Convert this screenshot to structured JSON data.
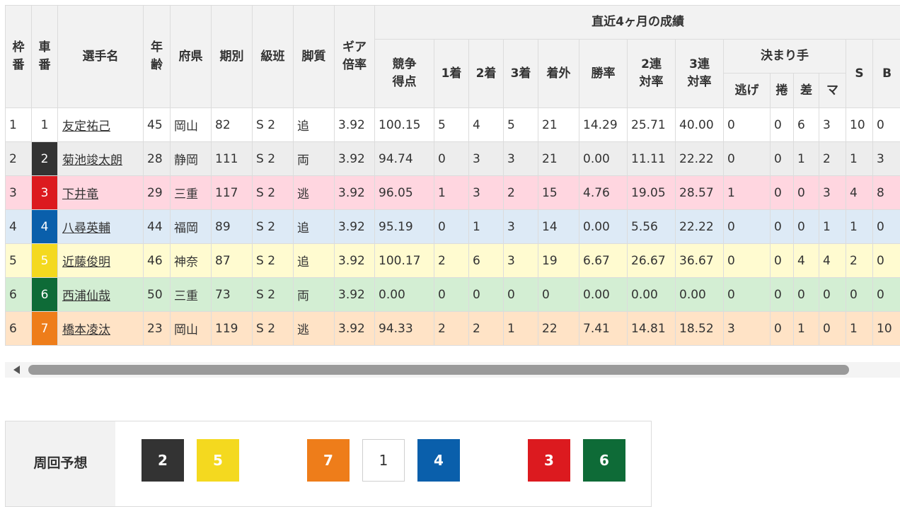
{
  "headers": {
    "waku": "枠番",
    "sha": "車番",
    "name": "選手名",
    "age": "年齢",
    "pref": "府県",
    "term": "期別",
    "class": "級班",
    "style": "脚質",
    "gear": "ギア倍率",
    "recent": "直近4ヶ月の成績",
    "score": "競争得点",
    "first": "1着",
    "second": "2着",
    "third": "3着",
    "out": "着外",
    "win_rate": "勝率",
    "rate2": "2連対率",
    "rate3": "3連対率",
    "kimarite": "決まり手",
    "nige": "逃げ",
    "makuri": "捲",
    "sashi": "差",
    "mark": "マ",
    "s": "S",
    "b": "B"
  },
  "riders": [
    {
      "waku": "1",
      "car": "1",
      "car_color": "c1",
      "name": "友定祐己",
      "age": "45",
      "pref": "岡山",
      "term": "82",
      "class": "S 2",
      "style": "追",
      "gear": "3.92",
      "score": "100.15",
      "first": "5",
      "second": "4",
      "third": "5",
      "out": "21",
      "win_rate": "14.29",
      "rate2": "25.71",
      "rate3": "40.00",
      "nige": "0",
      "makuri": "0",
      "sashi": "6",
      "mark": "3",
      "s": "10",
      "b": "0",
      "row_bg": "#ffffff"
    },
    {
      "waku": "2",
      "car": "2",
      "car_color": "c2",
      "name": "菊池竣太朗",
      "age": "28",
      "pref": "静岡",
      "term": "111",
      "class": "S 2",
      "style": "両",
      "gear": "3.92",
      "score": "94.74",
      "first": "0",
      "second": "3",
      "third": "3",
      "out": "21",
      "win_rate": "0.00",
      "rate2": "11.11",
      "rate3": "22.22",
      "nige": "0",
      "makuri": "0",
      "sashi": "1",
      "mark": "2",
      "s": "1",
      "b": "3",
      "row_bg": "#ededed"
    },
    {
      "waku": "3",
      "car": "3",
      "car_color": "c3",
      "name": "下井竜",
      "age": "29",
      "pref": "三重",
      "term": "117",
      "class": "S 2",
      "style": "逃",
      "gear": "3.92",
      "score": "96.05",
      "first": "1",
      "second": "3",
      "third": "2",
      "out": "15",
      "win_rate": "4.76",
      "rate2": "19.05",
      "rate3": "28.57",
      "nige": "1",
      "makuri": "0",
      "sashi": "0",
      "mark": "3",
      "s": "4",
      "b": "8",
      "row_bg": "#ffd6e0"
    },
    {
      "waku": "4",
      "car": "4",
      "car_color": "c4",
      "name": "八尋英輔",
      "age": "44",
      "pref": "福岡",
      "term": "89",
      "class": "S 2",
      "style": "追",
      "gear": "3.92",
      "score": "95.19",
      "first": "0",
      "second": "1",
      "third": "3",
      "out": "14",
      "win_rate": "0.00",
      "rate2": "5.56",
      "rate3": "22.22",
      "nige": "0",
      "makuri": "0",
      "sashi": "0",
      "mark": "1",
      "s": "1",
      "b": "0",
      "row_bg": "#ddeaf6"
    },
    {
      "waku": "5",
      "car": "5",
      "car_color": "c5",
      "name": "近藤俊明",
      "age": "46",
      "pref": "神奈",
      "term": "87",
      "class": "S 2",
      "style": "追",
      "gear": "3.92",
      "score": "100.17",
      "first": "2",
      "second": "6",
      "third": "3",
      "out": "19",
      "win_rate": "6.67",
      "rate2": "26.67",
      "rate3": "36.67",
      "nige": "0",
      "makuri": "0",
      "sashi": "4",
      "mark": "4",
      "s": "2",
      "b": "0",
      "row_bg": "#fffbd0"
    },
    {
      "waku": "6",
      "car": "6",
      "car_color": "c6",
      "name": "西浦仙哉",
      "age": "50",
      "pref": "三重",
      "term": "73",
      "class": "S 2",
      "style": "両",
      "gear": "3.92",
      "score": "0.00",
      "first": "0",
      "second": "0",
      "third": "0",
      "out": "0",
      "win_rate": "0.00",
      "rate2": "0.00",
      "rate3": "0.00",
      "nige": "0",
      "makuri": "0",
      "sashi": "0",
      "mark": "0",
      "s": "0",
      "b": "0",
      "row_bg": "#d3eed3"
    },
    {
      "waku": "6",
      "car": "7",
      "car_color": "c7",
      "name": "橋本凌汰",
      "age": "23",
      "pref": "岡山",
      "term": "119",
      "class": "S 2",
      "style": "逃",
      "gear": "3.92",
      "score": "94.33",
      "first": "2",
      "second": "2",
      "third": "1",
      "out": "22",
      "win_rate": "7.41",
      "rate2": "14.81",
      "rate3": "18.52",
      "nige": "3",
      "makuri": "0",
      "sashi": "1",
      "mark": "0",
      "s": "1",
      "b": "10",
      "row_bg": "#ffe3c6"
    }
  ],
  "forecast": {
    "label": "周回予想",
    "chips": [
      {
        "num": "2",
        "color": "c2",
        "slot": 0
      },
      {
        "num": "5",
        "color": "c5",
        "slot": 1
      },
      {
        "num": "7",
        "color": "c7",
        "slot": 3
      },
      {
        "num": "1",
        "color": "c1",
        "slot": 4
      },
      {
        "num": "4",
        "color": "c4",
        "slot": 5
      },
      {
        "num": "3",
        "color": "c3",
        "slot": 7
      },
      {
        "num": "6",
        "color": "c6",
        "slot": 8
      }
    ]
  }
}
